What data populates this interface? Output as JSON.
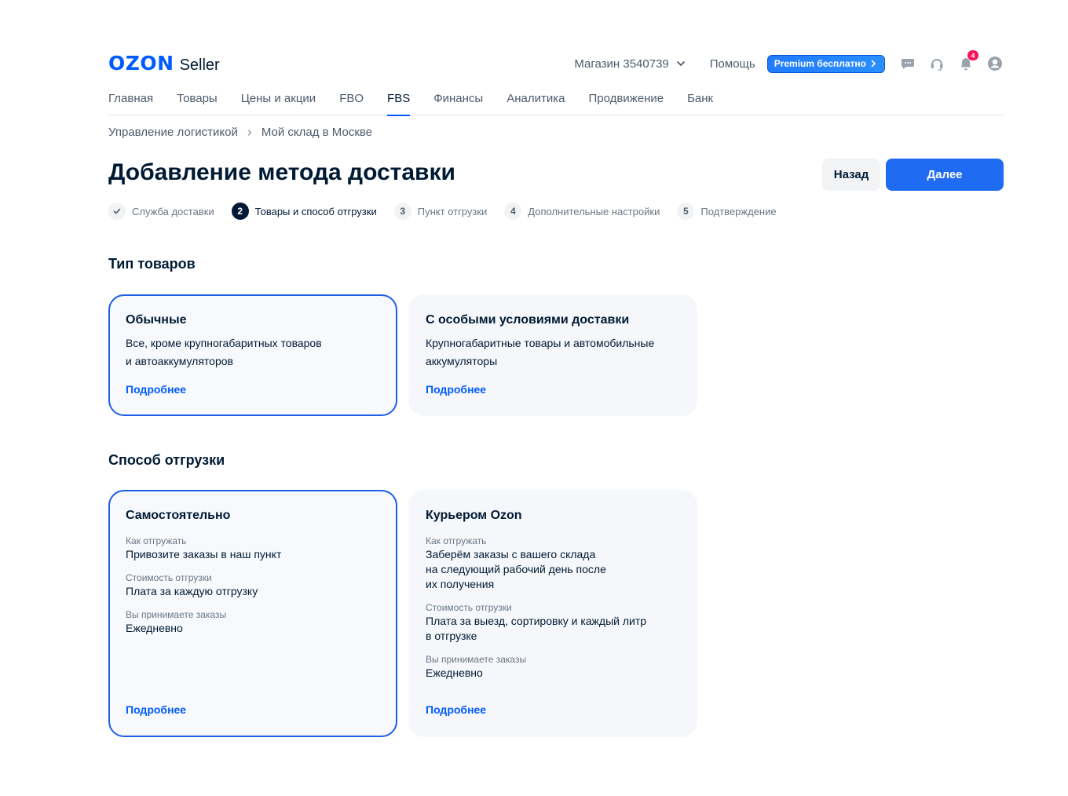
{
  "header": {
    "logo_text": "OZON",
    "logo_suffix": "Seller",
    "store_label": "Магазин 3540739",
    "help_label": "Помощь",
    "premium_label": "Premium бесплатно",
    "notifications_count": "4",
    "icons": [
      "chevron-down-icon",
      "chevron-right-icon",
      "chat-icon",
      "support-headset-icon",
      "bell-icon",
      "user-avatar-icon"
    ]
  },
  "nav": {
    "items": [
      "Главная",
      "Товары",
      "Цены и акции",
      "FBO",
      "FBS",
      "Финансы",
      "Аналитика",
      "Продвижение",
      "Банк"
    ],
    "active": "FBS"
  },
  "breadcrumb": {
    "items": [
      "Управление логистикой",
      "Мой склад в Москве"
    ]
  },
  "page": {
    "title": "Добавление метода доставки",
    "back_label": "Назад",
    "next_label": "Далее"
  },
  "stepper": {
    "steps": [
      {
        "num": "",
        "label": "Служба доставки",
        "state": "done"
      },
      {
        "num": "2",
        "label": "Товары и способ отгрузки",
        "state": "active"
      },
      {
        "num": "3",
        "label": "Пункт отгрузки",
        "state": "pending"
      },
      {
        "num": "4",
        "label": "Дополнительные настройки",
        "state": "pending"
      },
      {
        "num": "5",
        "label": "Подтверждение",
        "state": "pending"
      }
    ]
  },
  "goods_type": {
    "title": "Тип товаров",
    "cards": [
      {
        "title": "Обычные",
        "desc_line1": "Все, кроме крупногабаритных товаров",
        "desc_line2": "и автоаккумуляторов",
        "more": "Подробнее",
        "selected": true
      },
      {
        "title": "С особыми условиями доставки",
        "desc_line1": "Крупногабаритные товары и автомобильные",
        "desc_line2": "аккумуляторы",
        "more": "Подробнее",
        "selected": false
      }
    ]
  },
  "shipping": {
    "title": "Способ отгрузки",
    "cards": [
      {
        "title": "Самостоятельно",
        "how_label": "Как отгружать",
        "how_value": [
          "Привозите заказы в наш пункт"
        ],
        "cost_label": "Стоимость отгрузки",
        "cost_value": [
          "Плата за каждую отгрузку"
        ],
        "accept_label": "Вы принимаете заказы",
        "accept_value": "Ежедневно",
        "more": "Подробнее",
        "selected": true
      },
      {
        "title": "Курьером Ozon",
        "how_label": "Как отгружать",
        "how_value": [
          "Заберём заказы с вашего склада",
          "на следующий рабочий день после",
          "их получения"
        ],
        "cost_label": "Стоимость отгрузки",
        "cost_value": [
          "Плата за выезд, сортировку и каждый литр",
          "в отгрузке"
        ],
        "accept_label": "Вы принимаете заказы",
        "accept_value": "Ежедневно",
        "more": "Подробнее",
        "selected": false
      }
    ]
  },
  "colors": {
    "brand": "#005bff",
    "primary_button": "#1f6bf2",
    "selected_border": "#1d5ee4",
    "badge": "#f91155",
    "text": "#001a34",
    "muted": "#4d5b6b"
  }
}
